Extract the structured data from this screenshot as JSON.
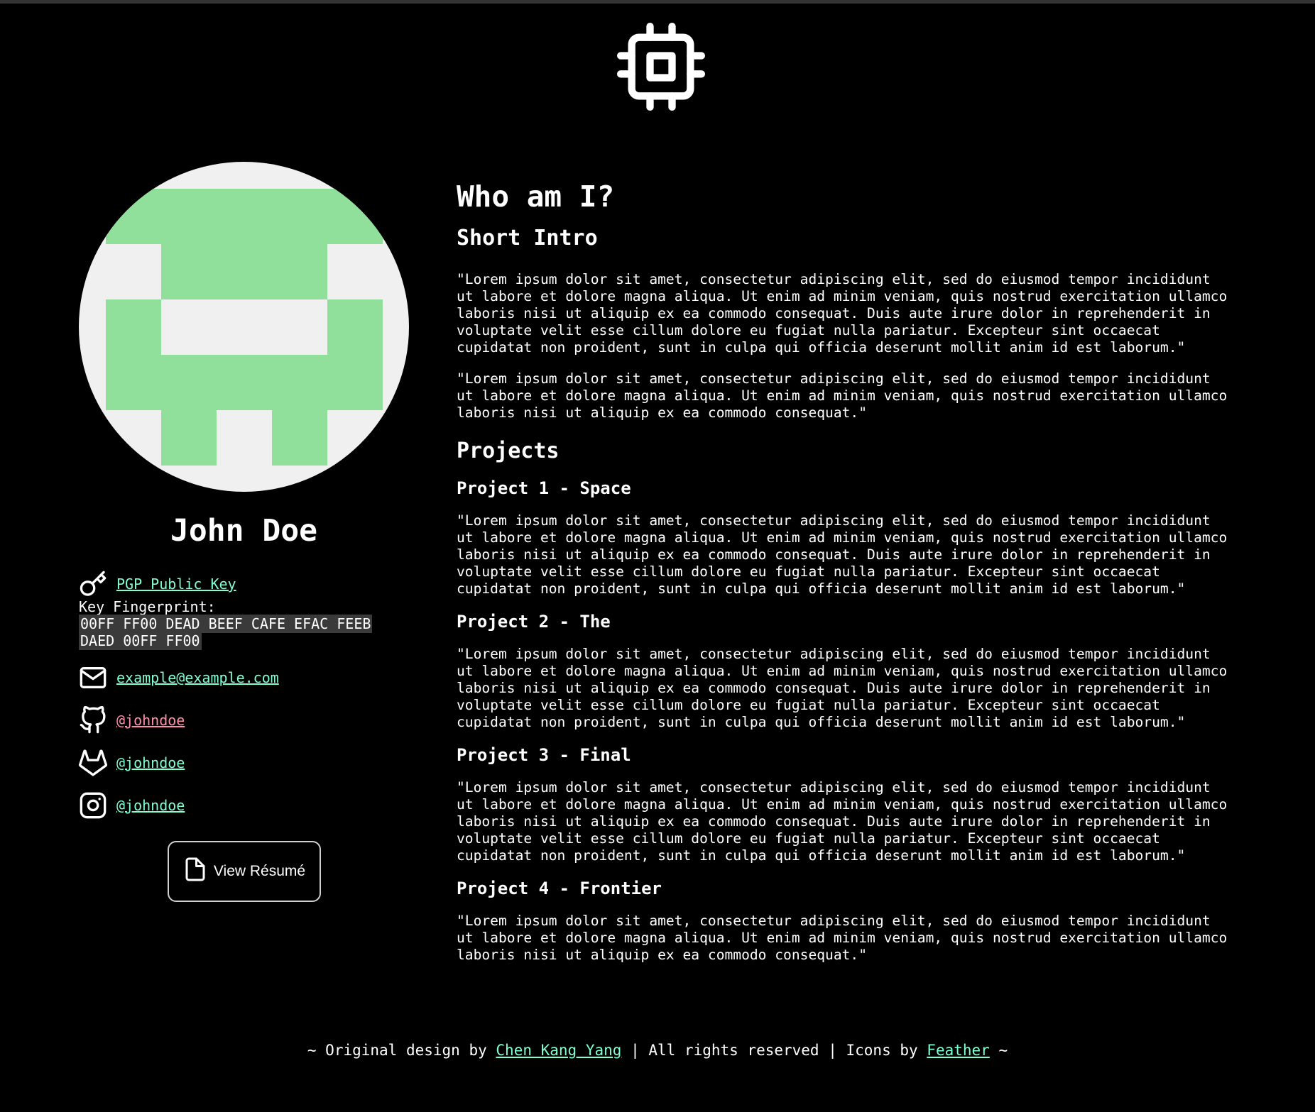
{
  "logo": {
    "icon": "cpu-icon"
  },
  "profile": {
    "avatar_icon": "pixel-avatar-icon",
    "avatar_colors": {
      "bg": "#f0f0f0",
      "fg": "#90e09c"
    },
    "name": "John Doe",
    "pgp_label": "PGP Public Key",
    "fingerprint_label": "Key Fingerprint:",
    "fingerprint_value": "00FF FF00 DEAD BEEF CAFE EFAC FEEB DAED 00FF FF00",
    "email": "example@example.com",
    "github": "@johndoe",
    "gitlab": "@johndoe",
    "instagram": "@johndoe",
    "resume_label": "View Résumé"
  },
  "main": {
    "title": "Who am I?",
    "intro_heading": "Short Intro",
    "intro_p1": "\"Lorem ipsum dolor sit amet, consectetur adipiscing elit, sed do eiusmod tempor incididunt\nut labore et dolore magna aliqua. Ut enim ad minim veniam, quis nostrud exercitation ullamco\nlaboris nisi ut aliquip ex ea commodo consequat. Duis aute irure dolor in reprehenderit in\nvoluptate velit esse cillum dolore eu fugiat nulla pariatur. Excepteur sint occaecat\ncupidatat non proident, sunt in culpa qui officia deserunt mollit anim id est laborum.\"",
    "intro_p2": "\"Lorem ipsum dolor sit amet, consectetur adipiscing elit, sed do eiusmod tempor incididunt\nut labore et dolore magna aliqua. Ut enim ad minim veniam, quis nostrud exercitation ullamco\nlaboris nisi ut aliquip ex ea commodo consequat.\"",
    "projects_heading": "Projects",
    "projects": [
      {
        "title": "Project 1 - Space",
        "text": "\"Lorem ipsum dolor sit amet, consectetur adipiscing elit, sed do eiusmod tempor incididunt\nut labore et dolore magna aliqua. Ut enim ad minim veniam, quis nostrud exercitation ullamco\nlaboris nisi ut aliquip ex ea commodo consequat. Duis aute irure dolor in reprehenderit in\nvoluptate velit esse cillum dolore eu fugiat nulla pariatur. Excepteur sint occaecat\ncupidatat non proident, sunt in culpa qui officia deserunt mollit anim id est laborum.\""
      },
      {
        "title": "Project 2 - The",
        "text": "\"Lorem ipsum dolor sit amet, consectetur adipiscing elit, sed do eiusmod tempor incididunt\nut labore et dolore magna aliqua. Ut enim ad minim veniam, quis nostrud exercitation ullamco\nlaboris nisi ut aliquip ex ea commodo consequat. Duis aute irure dolor in reprehenderit in\nvoluptate velit esse cillum dolore eu fugiat nulla pariatur. Excepteur sint occaecat\ncupidatat non proident, sunt in culpa qui officia deserunt mollit anim id est laborum.\""
      },
      {
        "title": "Project 3 - Final",
        "text": "\"Lorem ipsum dolor sit amet, consectetur adipiscing elit, sed do eiusmod tempor incididunt\nut labore et dolore magna aliqua. Ut enim ad minim veniam, quis nostrud exercitation ullamco\nlaboris nisi ut aliquip ex ea commodo consequat. Duis aute irure dolor in reprehenderit in\nvoluptate velit esse cillum dolore eu fugiat nulla pariatur. Excepteur sint occaecat\ncupidatat non proident, sunt in culpa qui officia deserunt mollit anim id est laborum.\""
      },
      {
        "title": "Project 4 - Frontier",
        "text": "\"Lorem ipsum dolor sit amet, consectetur adipiscing elit, sed do eiusmod tempor incididunt\nut labore et dolore magna aliqua. Ut enim ad minim veniam, quis nostrud exercitation ullamco\nlaboris nisi ut aliquip ex ea commodo consequat.\""
      }
    ]
  },
  "footer": {
    "prefix": "~ Original design by ",
    "author": "Chen Kang Yang",
    "middle": " | All rights reserved | Icons by ",
    "icons_by": "Feather",
    "suffix": " ~"
  },
  "colors": {
    "link": "#7fffd4",
    "github_link": "#ff8fa8",
    "background": "#000000"
  }
}
